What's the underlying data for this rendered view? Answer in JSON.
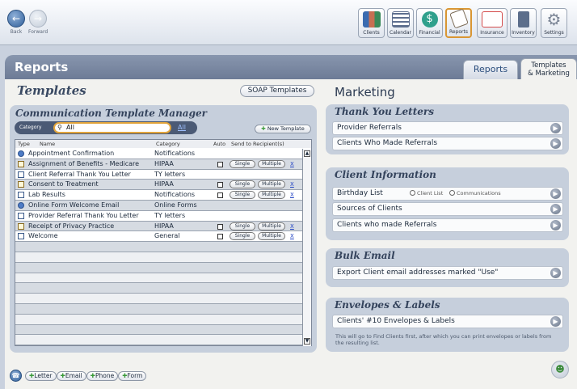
{
  "nav": {
    "back_label": "Back",
    "forward_label": "Forward"
  },
  "toolbar": [
    {
      "label": "Clients",
      "icon": "clients-icon",
      "color": "#c76f52"
    },
    {
      "label": "Calendar",
      "icon": "calendar-icon",
      "color": "#5e6f8f"
    },
    {
      "label": "Financial",
      "icon": "dollar-icon",
      "color": "#2fa08c"
    },
    {
      "label": "Reports",
      "icon": "reports-icon",
      "color": "#7a6a55",
      "active": true
    },
    {
      "label": "Insurance",
      "icon": "insurance-form-icon",
      "color": "#d44b4b"
    },
    {
      "label": "Inventory",
      "icon": "inventory-icon",
      "color": "#5c6e8b"
    },
    {
      "label": "Settings",
      "icon": "gear-icon",
      "color": "#7d8797"
    }
  ],
  "header": {
    "title": "Reports"
  },
  "tabs": [
    {
      "label": "Reports"
    },
    {
      "label_line1": "Templates",
      "label_line2": "& Marketing",
      "active": true
    }
  ],
  "templates": {
    "title": "Templates",
    "soap_button": "SOAP Templates",
    "manager_title": "Communication Template Manager",
    "category_label": "Category",
    "category_value": "All",
    "all_link": "All",
    "new_template": "New Template",
    "columns": {
      "type": "Type",
      "name": "Name",
      "category": "Category",
      "auto": "Auto",
      "send": "Send to Recipient(s)"
    },
    "rows": [
      {
        "type": "notification",
        "name": "Appointment Confirmation",
        "category": "Notifications",
        "auto": false,
        "has_send": false
      },
      {
        "type": "hipaa",
        "name": "Assignment of Benefits - Medicare",
        "category": "HIPAA",
        "auto": true,
        "has_send": true,
        "single": "Single",
        "multiple": "Multiple",
        "delete": "X"
      },
      {
        "type": "letter",
        "name": "Client Referral Thank You Letter",
        "category": "TY letters",
        "auto": false,
        "has_send": false
      },
      {
        "type": "hipaa",
        "name": "Consent to Treatment",
        "category": "HIPAA",
        "auto": true,
        "has_send": true,
        "single": "Single",
        "multiple": "Multiple",
        "delete": "X"
      },
      {
        "type": "letter",
        "name": "Lab Results",
        "category": "Notifications",
        "auto": true,
        "has_send": true,
        "single": "Single",
        "multiple": "Multiple",
        "delete": "X"
      },
      {
        "type": "notification",
        "name": "Online Form Welcome Email",
        "category": "Online Forms",
        "auto": false,
        "has_send": false
      },
      {
        "type": "letter",
        "name": "Provider Referral Thank You Letter",
        "category": "TY letters",
        "auto": false,
        "has_send": false
      },
      {
        "type": "hipaa",
        "name": "Receipt of Privacy Practice",
        "category": "HIPAA",
        "auto": true,
        "has_send": true,
        "single": "Single",
        "multiple": "Multiple",
        "delete": "X"
      },
      {
        "type": "letter",
        "name": "Welcome",
        "category": "General",
        "auto": true,
        "has_send": true,
        "single": "Single",
        "multiple": "Multiple",
        "delete": "X"
      }
    ]
  },
  "marketing": {
    "title": "Marketing",
    "thank_you": {
      "title": "Thank You Letters",
      "items": [
        "Provider Referrals",
        "Clients Who Made Referrals"
      ]
    },
    "client_info": {
      "title": "Client Information",
      "birthday": "Birthday List",
      "radio1": "Client List",
      "radio2": "Communications",
      "items": [
        "Sources of Clients",
        "Clients who made Referrals"
      ]
    },
    "bulk_email": {
      "title": "Bulk Email",
      "item": "Export Client email addresses marked \"Use\""
    },
    "envelopes": {
      "title": "Envelopes & Labels",
      "item": "Clients' #10 Envelopes & Labels",
      "note": "This will go to Find Clients first, after which you can print envelopes or labels from the resulting list."
    }
  },
  "bottom": {
    "letter": "Letter",
    "email": "Email",
    "phone": "Phone",
    "form": "Form"
  }
}
